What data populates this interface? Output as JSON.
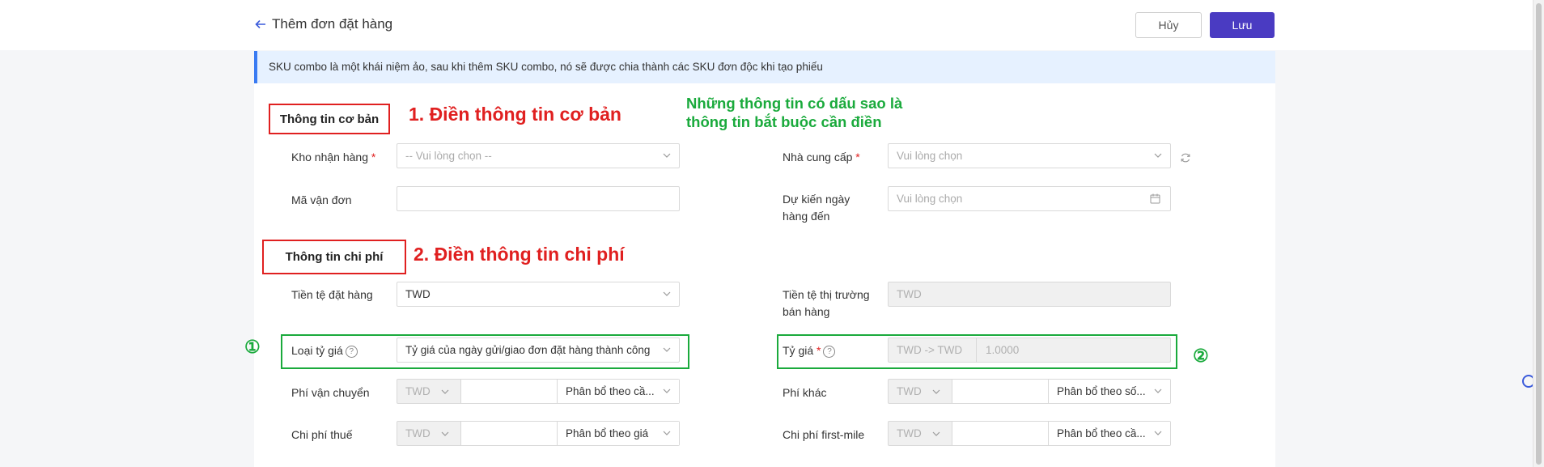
{
  "header": {
    "title": "Thêm đơn đặt hàng",
    "cancel_label": "Hủy",
    "save_label": "Lưu"
  },
  "notice": "SKU combo là một khái niệm ảo, sau khi thêm SKU combo, nó sẽ được chia thành các SKU đơn độc khi tạo phiếu",
  "annotations": {
    "step1": "1. Điền thông tin cơ bản",
    "step2": "2. Điền thông tin chi phí",
    "required_note_line1": "Những thông tin có dấu sao là",
    "required_note_line2": "thông tin bắt buộc cần điền",
    "circle1": "①",
    "circle2": "②"
  },
  "basic": {
    "title": "Thông tin cơ bản",
    "warehouse_label": "Kho nhận hàng",
    "warehouse_placeholder": "-- Vui lòng chọn --",
    "supplier_label": "Nhà cung cấp",
    "supplier_placeholder": "Vui lòng chọn",
    "tracking_label": "Mã vận đơn",
    "tracking_value": "",
    "eta_label_line1": "Dự kiến ngày",
    "eta_label_line2": "hàng đến",
    "eta_placeholder": "Vui lòng chọn"
  },
  "cost": {
    "title": "Thông tin chi phí",
    "order_currency_label": "Tiền tệ đặt hàng",
    "order_currency_value": "TWD",
    "market_currency_label_line1": "Tiền tệ thị trường",
    "market_currency_label_line2": "bán hàng",
    "market_currency_value": "TWD",
    "rate_type_label": "Loại tỷ giá",
    "rate_type_value": "Tỷ giá của ngày gửi/giao đơn đặt hàng thành công",
    "rate_label": "Tỷ giá",
    "rate_pair": "TWD -> TWD",
    "rate_value": "1.0000",
    "shipping_label": "Phí vận chuyển",
    "shipping_currency": "TWD",
    "shipping_alloc": "Phân bổ theo cầ...",
    "other_label": "Phí khác",
    "other_currency": "TWD",
    "other_alloc": "Phân bổ theo số...",
    "tax_label": "Chi phí thuế",
    "tax_currency": "TWD",
    "tax_alloc": "Phân bổ theo giá",
    "firstmile_label": "Chi phí first-mile",
    "firstmile_currency": "TWD",
    "firstmile_alloc": "Phân bổ theo cầ..."
  },
  "colors": {
    "accent": "#4a3bc2",
    "required": "#e02020",
    "annotation_red": "#e02020",
    "annotation_green": "#1aaa3c",
    "notice_bg": "#e6f1ff"
  },
  "icons": [
    "arrow-left-icon",
    "chevron-down-icon",
    "calendar-icon",
    "refresh-icon",
    "help-icon",
    "search-icon"
  ]
}
